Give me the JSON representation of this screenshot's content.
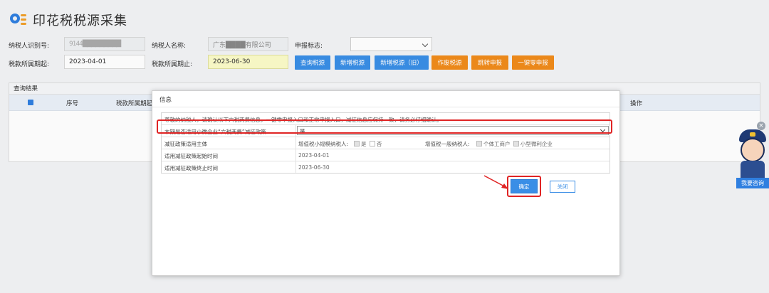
{
  "page": {
    "title": "印花税税源采集"
  },
  "form": {
    "taxpayer_id_label": "纳税人识别号:",
    "taxpayer_id_value": "9144█████████",
    "taxpayer_name_label": "纳税人名称:",
    "taxpayer_name_value": "广东████有限公司",
    "declare_flag_label": "申报标志:",
    "declare_flag_value": "",
    "period_start_label": "税款所属期起:",
    "period_start_value": "2023-04-01",
    "period_end_label": "税款所属期止:",
    "period_end_value": "2023-06-30"
  },
  "toolbar": {
    "query": "查询税源",
    "add": "新增税源",
    "add_old": "新增税源（旧）",
    "void": "作废税源",
    "jump": "跳转申报",
    "zero": "一键零申报"
  },
  "results": {
    "panel_title": "查询结果",
    "col_seq": "序号",
    "col_period": "税款所属期起",
    "col_op": "操作"
  },
  "dialog": {
    "title": "信息",
    "notice": "尊敬的纳税人，请确认以下六税两费信息，一键零申报入口和正常申报入口，减征信息应保持一致，请务必仔细确认。",
    "row1_label": "本期是否适用小微企业“六税两费”减征政策",
    "row1_value": "是",
    "row2_label": "减征政策适用主体",
    "row2_small_label": "增值税小规模纳税人:",
    "row2_yes": "是",
    "row2_no": "否",
    "row2_general_label": "增值税一般纳税人:",
    "row2_individual": "个体工商户",
    "row2_micro": "小型微利企业",
    "row3_label": "适用减征政策起始时间",
    "row3_value": "2023-04-01",
    "row4_label": "适用减征政策终止时间",
    "row4_value": "2023-06-30",
    "ok": "确定",
    "close": "关闭"
  },
  "assistant": {
    "label": "我要咨询",
    "close": "×"
  },
  "colors": {
    "primary": "#3a8ee6",
    "orange": "#f08b1b",
    "highlight": "#e02424"
  }
}
